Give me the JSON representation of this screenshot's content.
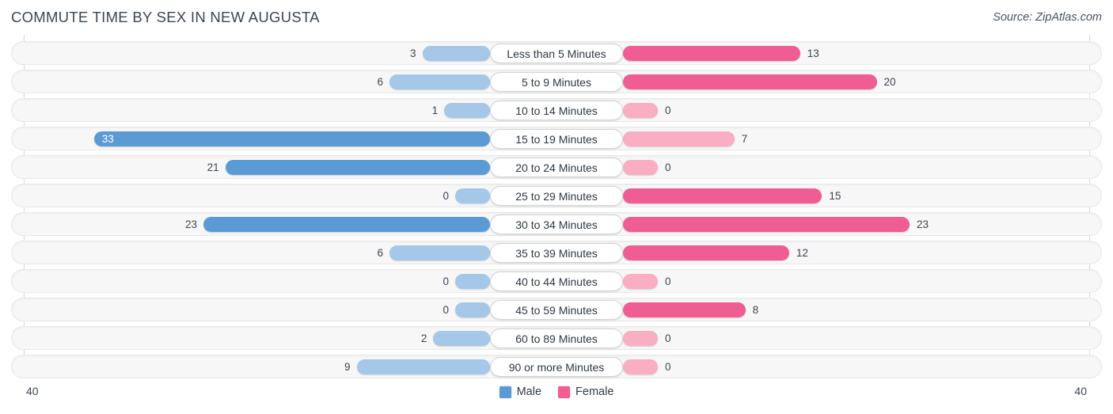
{
  "header": {
    "title": "COMMUTE TIME BY SEX IN NEW AUGUSTA",
    "source": "Source: ZipAtlas.com"
  },
  "legend": {
    "items": [
      {
        "label": "Male",
        "color": "#5b9bd5"
      },
      {
        "label": "Female",
        "color": "#ef5d92"
      }
    ]
  },
  "axis": {
    "left_end": "40",
    "right_end": "40"
  },
  "colors": {
    "male_strong": "#5b9bd5",
    "male_light": "#a6c8e8",
    "female_strong": "#ef5d92",
    "female_light": "#f9aec4",
    "track": "#f7f7f7",
    "track_border": "#e8e8e8",
    "axis_line": "#d9d9d9",
    "text": "#3d4450"
  },
  "chart_data": {
    "type": "bar",
    "subtype": "diverging-bidirectional",
    "title": "COMMUTE TIME BY SEX IN NEW AUGUSTA",
    "xlabel": "",
    "ylabel": "",
    "xlim": [
      40,
      40
    ],
    "axis_max": 40,
    "grid": false,
    "legend_position": "bottom-center",
    "categories": [
      "Less than 5 Minutes",
      "5 to 9 Minutes",
      "10 to 14 Minutes",
      "15 to 19 Minutes",
      "20 to 24 Minutes",
      "25 to 29 Minutes",
      "30 to 34 Minutes",
      "35 to 39 Minutes",
      "40 to 44 Minutes",
      "45 to 59 Minutes",
      "60 to 89 Minutes",
      "90 or more Minutes"
    ],
    "series": [
      {
        "name": "Male",
        "direction": "left",
        "values": [
          3,
          6,
          1,
          33,
          21,
          0,
          23,
          6,
          0,
          0,
          2,
          9
        ]
      },
      {
        "name": "Female",
        "direction": "right",
        "values": [
          13,
          20,
          0,
          7,
          0,
          15,
          23,
          12,
          0,
          8,
          0,
          0
        ]
      }
    ]
  }
}
